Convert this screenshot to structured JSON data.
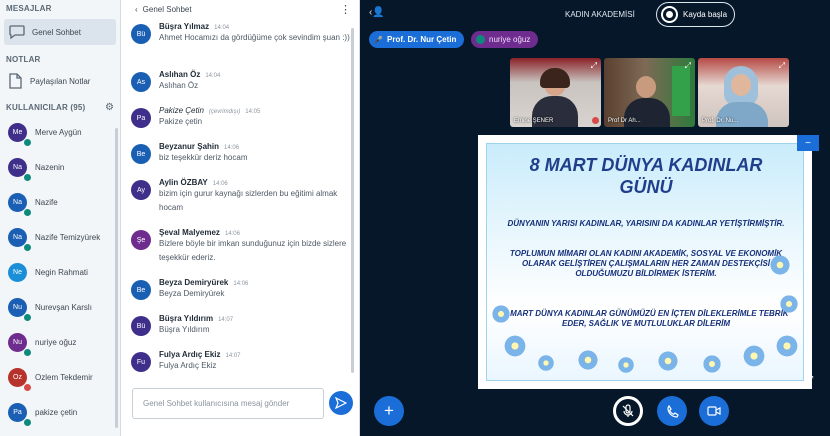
{
  "sidebar": {
    "messages_title": "MESAJLAR",
    "public_chat_label": "Genel Sohbet",
    "notes_title": "NOTLAR",
    "shared_notes_label": "Paylaşılan Notlar",
    "users_title": "KULLANICILAR (95)",
    "users": [
      {
        "initials": "Me",
        "name": "Merve Aygün",
        "color": "#3f2f8a",
        "status": "#0e8a7c"
      },
      {
        "initials": "Na",
        "name": "Nazenin",
        "color": "#3f2f8a",
        "status": "#0e8a7c"
      },
      {
        "initials": "Na",
        "name": "Nazife",
        "color": "#1a5fb4",
        "status": "#0e8a7c"
      },
      {
        "initials": "Na",
        "name": "Nazife Temizyürek",
        "color": "#1a5fb4",
        "status": "#0e8a7c"
      },
      {
        "initials": "Ne",
        "name": "Negin Rahmati",
        "color": "#1a8fd8",
        "status": ""
      },
      {
        "initials": "Nu",
        "name": "Nurevşan Karslı",
        "color": "#1a5fb4",
        "status": "#0e8a7c"
      },
      {
        "initials": "Nu",
        "name": "nuriye oğuz",
        "color": "#6f2c8f",
        "status": "#0e8a7c"
      },
      {
        "initials": "Oz",
        "name": "Ozlem Tekdemir",
        "color": "#b8322c",
        "status": "#d84a4a"
      },
      {
        "initials": "Pa",
        "name": "pakize çetin",
        "color": "#1a5fb4",
        "status": "#0e8a7c"
      }
    ]
  },
  "chat": {
    "title": "Genel Sohbet",
    "input_placeholder": "Genel Sohbet kullanıcısına mesaj gönder",
    "messages": [
      {
        "initials": "Bü",
        "color": "#1a5fb4",
        "author": "Büşra Yılmaz",
        "time": "14:04",
        "text": "Ahmet Hocamızı da gördüğüme çok sevindim şuan :))"
      },
      {
        "initials": "As",
        "color": "#1a5fb4",
        "author": "Aslıhan Öz",
        "time": "14:04",
        "text": "Aslıhan Öz"
      },
      {
        "initials": "Pa",
        "color": "#3f2f8a",
        "author": "Pakize Çetin",
        "role": "(çevrimdışı)",
        "time": "14:05",
        "text": "Pakize çetin"
      },
      {
        "initials": "Be",
        "color": "#1a5fb4",
        "author": "Beyzanur Şahin",
        "time": "14:06",
        "text": "biz teşekkür deriz hocam"
      },
      {
        "initials": "Ay",
        "color": "#3f2f8a",
        "author": "Aylin ÖZBAY",
        "time": "14:06",
        "text": "bizim için gurur kaynağı sizlerden bu eğitimi almak hocam"
      },
      {
        "initials": "Şe",
        "color": "#6f2c8f",
        "author": "Şeval Malyemez",
        "time": "14:06",
        "text": "Bizlere böyle bir imkan sunduğunuz için bizde sizlere teşekkür ederiz."
      },
      {
        "initials": "Be",
        "color": "#1a5fb4",
        "author": "Beyza Demiryürek",
        "time": "14:06",
        "text": "Beyza Demiryürek"
      },
      {
        "initials": "Bü",
        "color": "#3f2f8a",
        "author": "Büşra Yıldırım",
        "time": "14:07",
        "text": "Büşra Yıldırım"
      },
      {
        "initials": "Fu",
        "color": "#3f2f8a",
        "author": "Fulya Ardıç Ekiz",
        "time": "14:07",
        "text": "Fulya Ardıç Ekiz"
      }
    ]
  },
  "main": {
    "conference_title": "KADIN AKADEMİSİ",
    "record_label": "Kayda başla",
    "talkers": [
      {
        "name": "Prof. Dr. Nur Çetin"
      },
      {
        "name": "nuriye oğuz"
      }
    ],
    "videos": [
      {
        "name": "Emine ŞENER"
      },
      {
        "name": "Prof Dr Ah..."
      },
      {
        "name": "Prof. Dr. Nu..."
      }
    ],
    "slide": {
      "title": "8 MART DÜNYA KADINLAR GÜNÜ",
      "paragraph1": "DÜNYANIN YARISI KADINLAR, YARISINI DA KADINLAR YETİŞTİRMİŞTİR.",
      "paragraph2": "TOPLUMUN MİMARI OLAN KADINI AKADEMİK, SOSYAL VE EKONOMİK OLARAK GELİŞTİREN ÇALIŞMALARIN HER ZAMAN DESTEKÇİSİ OLDUĞUMUZU BİLDİRMEK İSTERİM.",
      "paragraph3": "8 MART DÜNYA KADINLAR GÜNÜMÜZÜ EN İÇTEN DİLEKLERİMLE TEBRİK EDER, SAĞLIK VE MUTLULUKLAR DİLERİM"
    }
  }
}
